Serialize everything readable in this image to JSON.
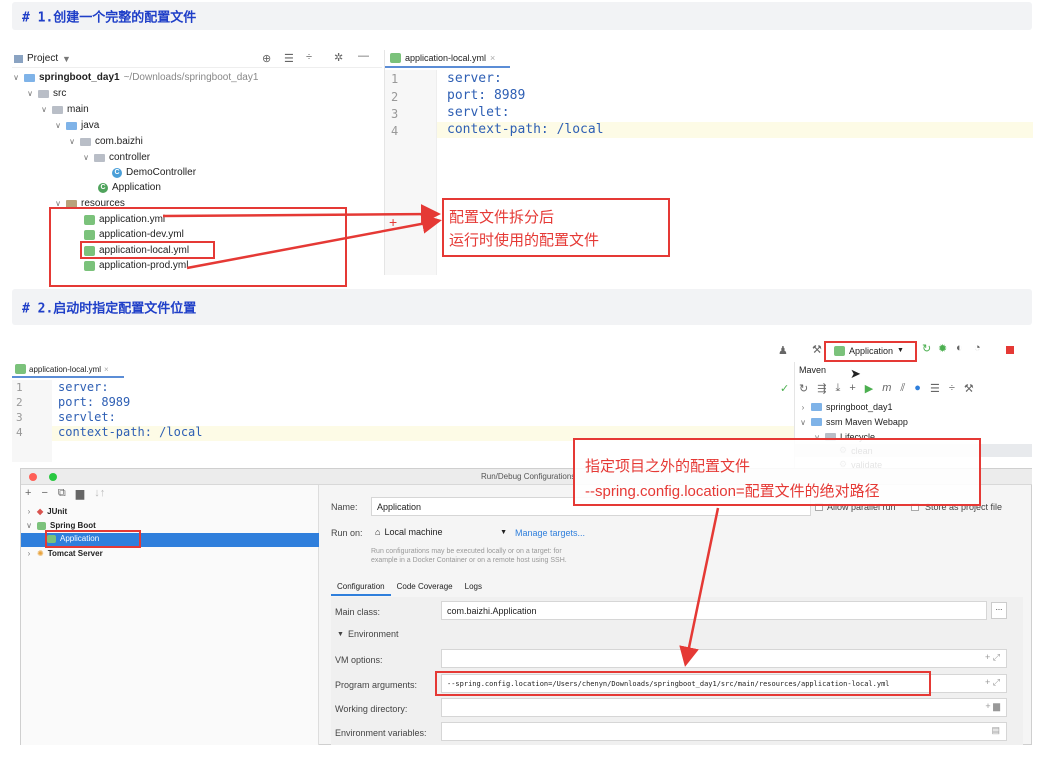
{
  "heading1": "# 1.创建一个完整的配置文件",
  "heading2": "# 2.启动时指定配置文件位置",
  "project_panel": {
    "title": "Project",
    "root_name": "springboot_day1",
    "root_path": "~/Downloads/springboot_day1",
    "items": {
      "src": "src",
      "main": "main",
      "java": "java",
      "package": "com.baizhi",
      "controller": "controller",
      "demo_controller": "DemoController",
      "application": "Application",
      "resources": "resources",
      "yml1": "application.yml",
      "yml2": "application-dev.yml",
      "yml3": "application-local.yml",
      "yml4": "application-prod.yml"
    }
  },
  "editor1": {
    "tab": "application-local.yml",
    "line_numbers": [
      "1",
      "2",
      "3",
      "4"
    ],
    "lines": [
      "server:",
      "  port: 8989",
      "  servlet:",
      "    context-path: /local"
    ]
  },
  "callout1": {
    "line1": "配置文件拆分后",
    "line2": "运行时使用的配置文件"
  },
  "toolbar": {
    "run_config": "Application"
  },
  "editor2": {
    "tab": "application-local.yml",
    "line_numbers": [
      "1",
      "2",
      "3",
      "4"
    ],
    "lines": [
      "server:",
      "  port: 8989",
      "  servlet:",
      "    context-path: /local"
    ]
  },
  "maven": {
    "title": "Maven",
    "project1": "springboot_day1",
    "project2": "ssm Maven Webapp",
    "lifecycle": "Lifecycle",
    "clean": "clean",
    "validate": "validate"
  },
  "callout2": {
    "line1": "指定项目之外的配置文件",
    "line2": "--spring.config.location=配置文件的绝对路径"
  },
  "run_dialog": {
    "title": "Run/Debug Configurations",
    "tree": {
      "junit": "JUnit",
      "spring_boot": "Spring Boot",
      "application": "Application",
      "tomcat": "Tomcat Server"
    },
    "name_label": "Name:",
    "name_value": "Application",
    "allow_parallel": "Allow parallel run",
    "store_project": "Store as project file",
    "run_on_label": "Run on:",
    "run_on_value": "Local machine",
    "manage_targets": "Manage targets...",
    "hint_line1": "Run configurations may be executed locally or on a target: for",
    "hint_line2": "example in a Docker Container or on a remote host using SSH.",
    "tabs": [
      "Configuration",
      "Code Coverage",
      "Logs"
    ],
    "main_class_label": "Main class:",
    "main_class_value": "com.baizhi.Application",
    "environment_label": "Environment",
    "vm_options_label": "VM options:",
    "program_args_label": "Program arguments:",
    "program_args_value": "--spring.config.location=/Users/chenyn/Downloads/springboot_day1/src/main/resources/application-local.yml",
    "working_dir_label": "Working directory:",
    "env_vars_label": "Environment variables:"
  },
  "colors": {
    "heading": "#1f3fc8",
    "annotation_red": "#e53935",
    "selection_blue": "#2f7fdc"
  }
}
